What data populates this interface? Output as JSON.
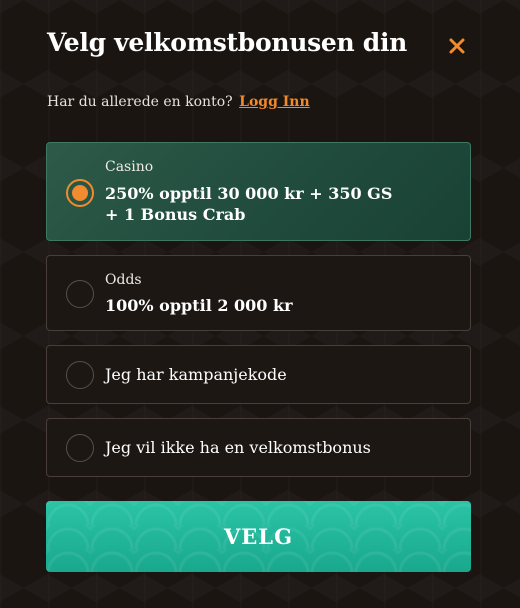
{
  "modal": {
    "title": "Velg velkomstbonusen din",
    "close_icon": "close-icon",
    "accent_color": "#f28a2e",
    "login_prompt": "Har du allerede en konto?",
    "login_link": "Logg Inn"
  },
  "options": [
    {
      "category": "Casino",
      "desc_line1": "250% opptil 30 000 kr + 350 GS",
      "desc_line2": "+ 1 Bonus Crab",
      "selected": true,
      "selected_color": "#2a5a48"
    },
    {
      "category": "Odds",
      "desc_line1": "100% opptil 2 000 kr",
      "selected": false
    },
    {
      "label": "Jeg har kampanjekode",
      "selected": false
    },
    {
      "label": "Jeg vil ikke ha en velkomstbonus",
      "selected": false
    }
  ],
  "cta": {
    "label": "VELG",
    "color": "#1fb79a"
  }
}
